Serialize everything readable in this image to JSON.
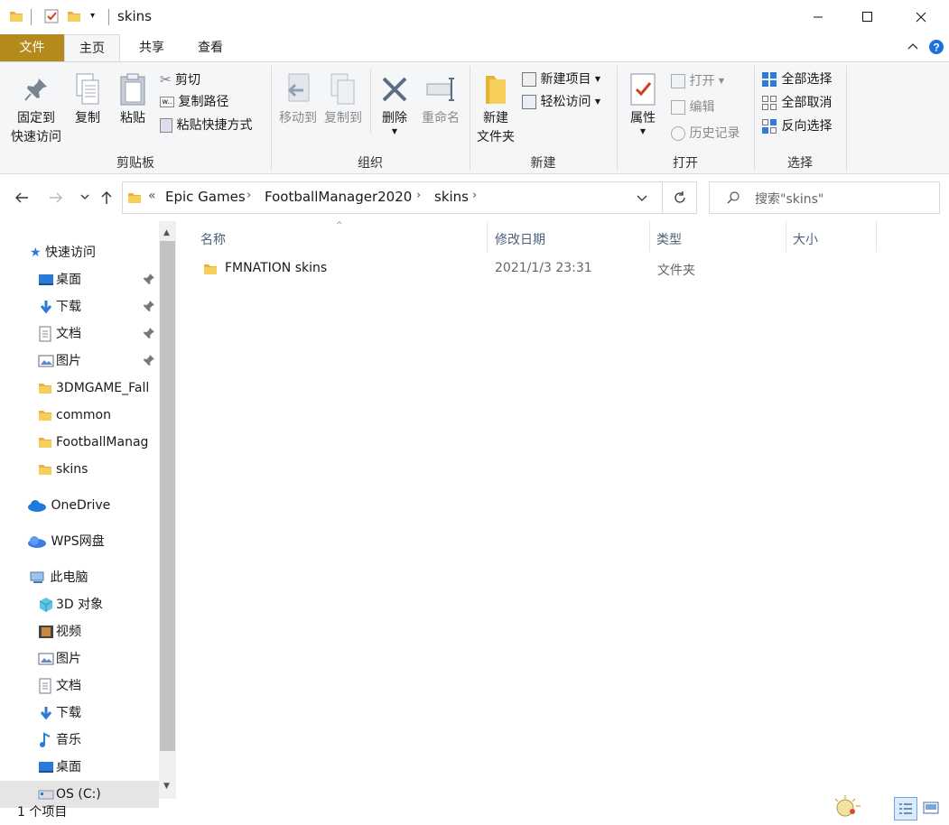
{
  "window": {
    "title": "skins",
    "minimize_icon": "minimize-icon",
    "maximize_icon": "maximize-icon",
    "close_icon": "close-icon"
  },
  "tabs": [
    {
      "label": "文件",
      "active": false,
      "file_tab": true
    },
    {
      "label": "主页",
      "active": true
    },
    {
      "label": "共享",
      "active": false
    },
    {
      "label": "查看",
      "active": false
    }
  ],
  "ribbon": {
    "clipboard": {
      "group_label": "剪贴板",
      "pin_line1": "固定到",
      "pin_line2": "快速访问",
      "copy": "复制",
      "paste": "粘贴",
      "cut": "剪切",
      "copy_path": "复制路径",
      "paste_shortcut": "粘贴快捷方式"
    },
    "organize": {
      "group_label": "组织",
      "move_to": "移动到",
      "copy_to": "复制到",
      "delete": "删除",
      "rename": "重命名"
    },
    "new": {
      "group_label": "新建",
      "new_folder_line1": "新建",
      "new_folder_line2": "文件夹",
      "new_item": "新建项目",
      "easy_access": "轻松访问"
    },
    "open": {
      "group_label": "打开",
      "properties": "属性",
      "open": "打开",
      "edit": "编辑",
      "history": "历史记录"
    },
    "select": {
      "group_label": "选择",
      "select_all": "全部选择",
      "select_none": "全部取消",
      "invert": "反向选择"
    }
  },
  "address": {
    "overflow": "«",
    "crumbs": [
      "Epic Games",
      "FootballManager2020",
      "skins"
    ],
    "search_placeholder": "搜索\"skins\""
  },
  "nav": {
    "quick_access": "快速访问",
    "quick_items": [
      {
        "label": "桌面",
        "icon": "desktop-icon",
        "pinned": true
      },
      {
        "label": "下载",
        "icon": "download-icon",
        "pinned": true
      },
      {
        "label": "文档",
        "icon": "document-icon",
        "pinned": true
      },
      {
        "label": "图片",
        "icon": "picture-icon",
        "pinned": true
      },
      {
        "label": "3DMGAME_Fall",
        "icon": "folder-icon",
        "pinned": false
      },
      {
        "label": "common",
        "icon": "folder-icon",
        "pinned": false
      },
      {
        "label": "FootballManag",
        "icon": "folder-icon",
        "pinned": false
      },
      {
        "label": "skins",
        "icon": "folder-icon",
        "pinned": false
      }
    ],
    "onedrive": "OneDrive",
    "wps": "WPS网盘",
    "this_pc": "此电脑",
    "pc_items": [
      {
        "label": "3D 对象",
        "icon": "3d-objects-icon"
      },
      {
        "label": "视频",
        "icon": "video-icon"
      },
      {
        "label": "图片",
        "icon": "picture-icon"
      },
      {
        "label": "文档",
        "icon": "document-icon"
      },
      {
        "label": "下载",
        "icon": "download-icon"
      },
      {
        "label": "音乐",
        "icon": "music-icon"
      },
      {
        "label": "桌面",
        "icon": "desktop-icon"
      },
      {
        "label": "OS (C:)",
        "icon": "drive-icon"
      }
    ]
  },
  "columns": {
    "name": "名称",
    "date": "修改日期",
    "type": "类型",
    "size": "大小"
  },
  "files": [
    {
      "name": "FMNATION skins",
      "date": "2021/1/3 23:31",
      "type": "文件夹",
      "size": ""
    }
  ],
  "status": {
    "count": "1 个项目"
  },
  "colors": {
    "file_tab": "#b58a1c",
    "accent_blue": "#0078d7",
    "folder": "#f4c24a"
  }
}
